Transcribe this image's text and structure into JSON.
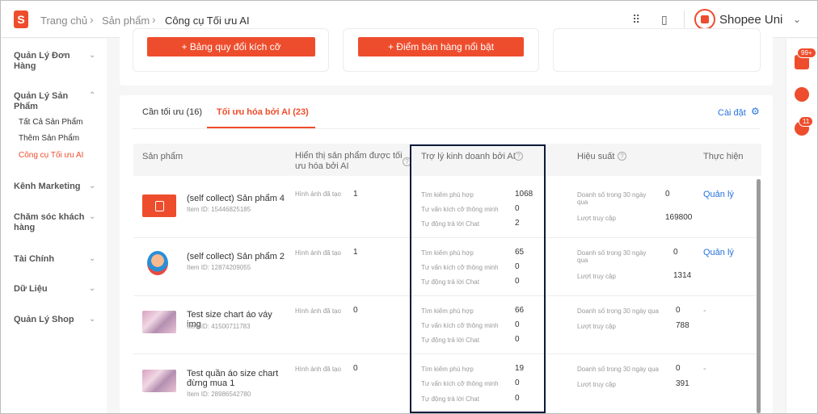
{
  "header": {
    "logo_letter": "S",
    "breadcrumbs": [
      "Trang chủ",
      "Sản phẩm",
      "Công cụ Tối ưu AI"
    ],
    "shop_name": "Shopee Uni"
  },
  "sidebar": {
    "groups": [
      {
        "label": "Quản Lý Đơn Hàng"
      },
      {
        "label": "Quản Lý Sản Phẩm",
        "items": [
          "Tất Cả Sản Phẩm",
          "Thêm Sản Phẩm",
          "Công cụ Tối ưu AI"
        ]
      },
      {
        "label": "Kênh Marketing"
      },
      {
        "label": "Chăm sóc khách hàng"
      },
      {
        "label": "Tài Chính"
      },
      {
        "label": "Dữ Liệu"
      },
      {
        "label": "Quản Lý Shop"
      }
    ]
  },
  "rail": {
    "badge_notifications": "99+",
    "badge_chat": "11"
  },
  "features": {
    "size_chart_button": "+ Bảng quy đổi kích cỡ",
    "highlights_button": "+ Điểm bán hàng nổi bật"
  },
  "tabs": {
    "needs_optimization": "Cần tối ưu (16)",
    "ai_optimized": "Tối ưu hóa bởi AI (23)",
    "settings": "Cài đặt"
  },
  "table": {
    "headers": {
      "product": "Sản phẩm",
      "display": "Hiển thị sản phẩm được tối ưu hóa bởi AI",
      "assistant": "Trợ lý kinh doanh bởi AI",
      "performance": "Hiệu suất",
      "action": "Thực hiện"
    },
    "labels": {
      "images_created": "Hình ảnh đã tạo",
      "search_match": "Tìm kiếm phù hợp",
      "smart_size": "Tư vấn kích cỡ thông minh",
      "auto_reply": "Tự động trả lời Chat",
      "sales_30d": "Doanh số trong 30 ngày qua",
      "visits": "Lượt truy cập",
      "manage": "Quản lý",
      "dash": "-"
    },
    "rows": [
      {
        "name": "(self collect) Sản phẩm 4",
        "item_id": "Item ID: 15446825185",
        "images": "1",
        "search": "1068",
        "size": "0",
        "reply": "2",
        "sales": "0",
        "visits": "169800",
        "action": "Quản lý"
      },
      {
        "name": "(self collect) Sản phẩm 2",
        "item_id": "Item ID: 12874209055",
        "images": "1",
        "search": "65",
        "size": "0",
        "reply": "0",
        "sales": "0",
        "visits": "1314",
        "action": "Quản lý"
      },
      {
        "name": "Test size chart áo váy img",
        "item_id": "Item ID: 41500711783",
        "images": "0",
        "search": "66",
        "size": "0",
        "reply": "0",
        "sales": "0",
        "visits": "788",
        "action": "-"
      },
      {
        "name": "Test quần áo size chart đừng mua 1",
        "item_id": "Item ID: 28986542780",
        "images": "0",
        "search": "19",
        "size": "0",
        "reply": "0",
        "sales": "0",
        "visits": "391",
        "action": "-"
      }
    ]
  }
}
